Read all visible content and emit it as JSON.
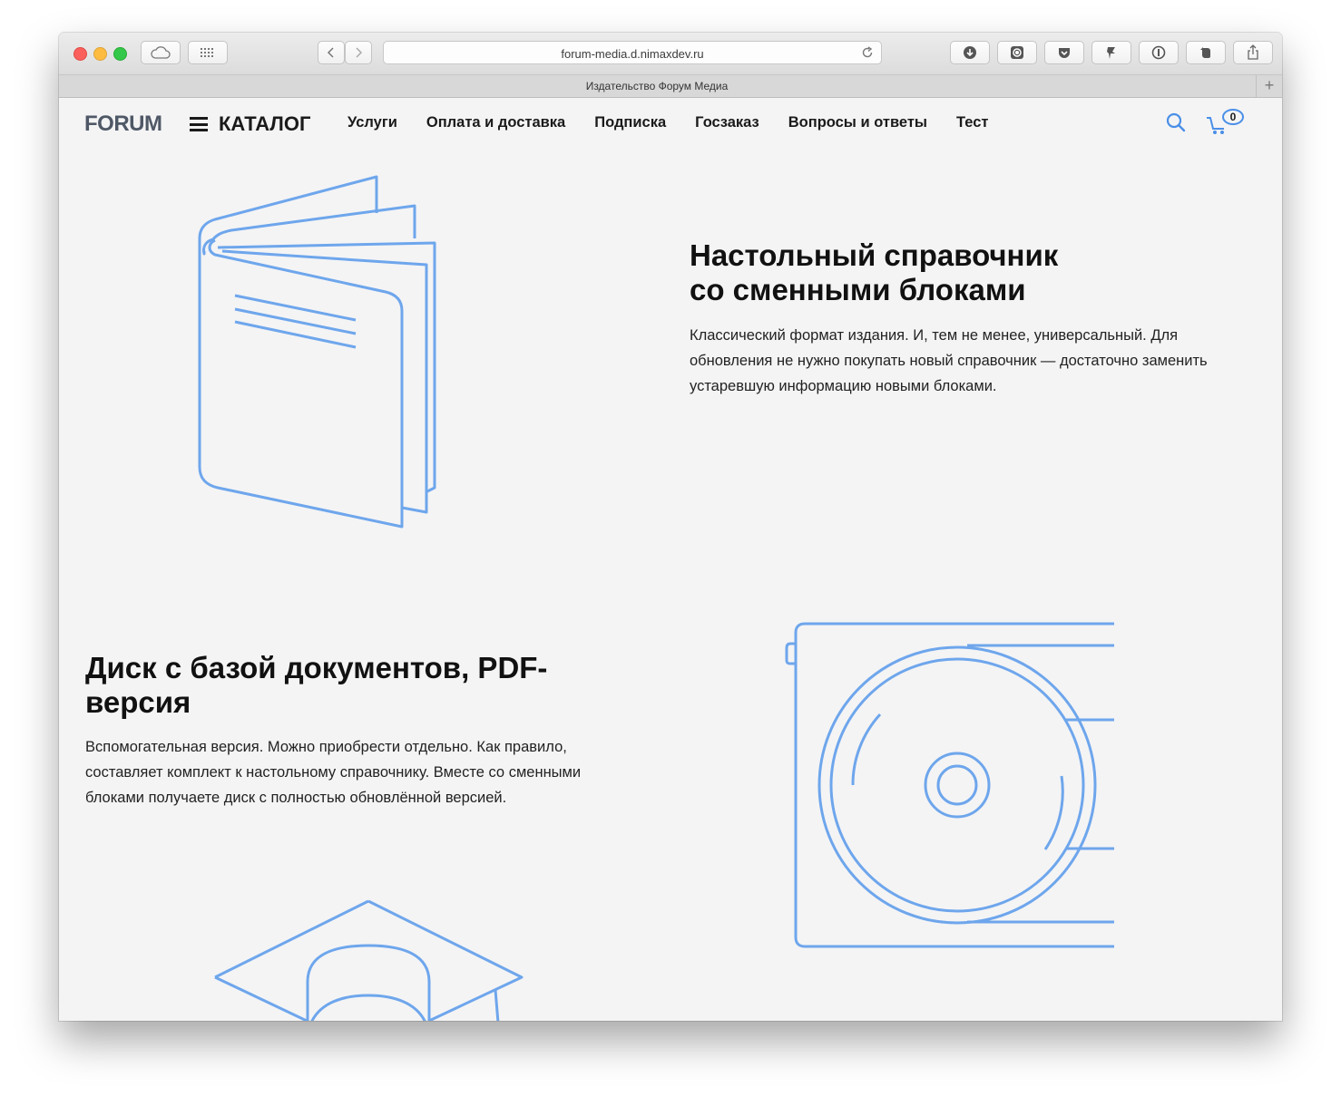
{
  "browser": {
    "url": "forum-media.d.nimaxdev.ru",
    "tab_title": "Издательство Форум Медиа",
    "tab_add": "+"
  },
  "header": {
    "logo": "FORUM",
    "catalog_label": "КАТАЛОГ",
    "menu": [
      {
        "label": "Услуги"
      },
      {
        "label": "Оплата и доставка"
      },
      {
        "label": "Подписка"
      },
      {
        "label": "Госзаказ"
      },
      {
        "label": "Вопросы и ответы"
      },
      {
        "label": "Тест"
      }
    ],
    "cart_count": "0"
  },
  "sections": [
    {
      "title_line1": "Настольный справочник",
      "title_line2": "со сменными блоками",
      "text_line1": "Классический формат издания. И, тем не менее, универсальный. Для",
      "text_line2": "обновления не нужно покупать новый справочник — достаточно заменить",
      "text_line3": "устаревшую информацию новыми блоками."
    },
    {
      "title_line1": "Диск с базой документов, PDF-",
      "title_line2": "версия",
      "text_line1": "Вспомогательная версия. Можно приобрести отдельно. Как правило,",
      "text_line2": "составляет комплект к настольному справочнику. Вместе со сменными",
      "text_line3": "блоками получаете диск с полностью обновлённой версией."
    }
  ],
  "colors": {
    "accent": "#4a8fe7",
    "illustration": "#6ea6ec",
    "logo": "#4f5866",
    "page_bg": "#f4f4f5"
  }
}
